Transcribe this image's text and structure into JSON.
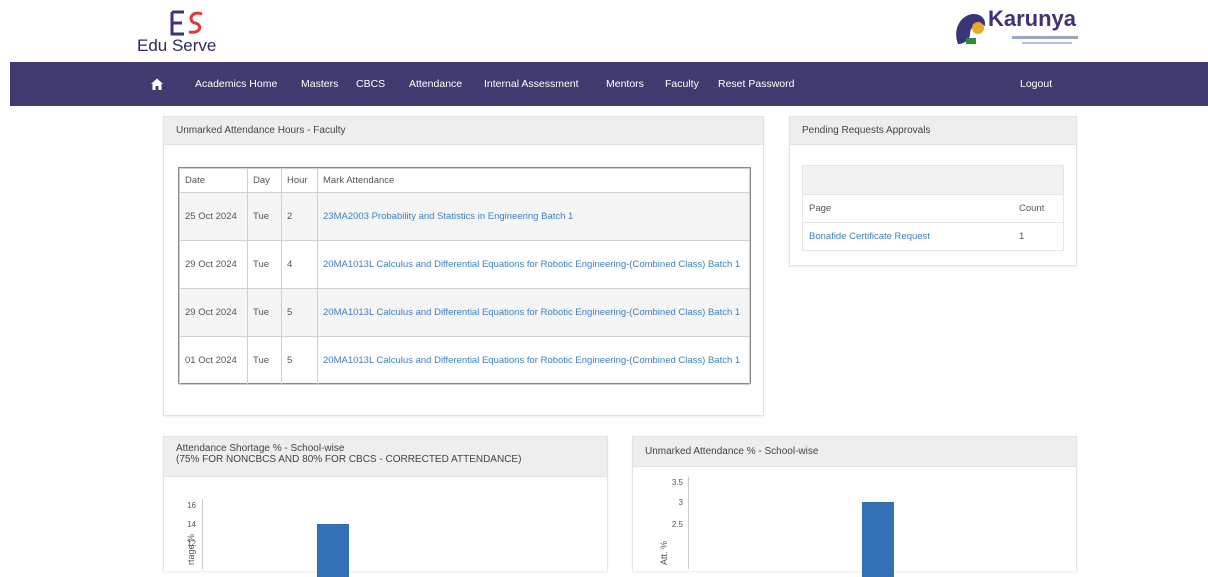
{
  "brand": {
    "name": "Edu Serve",
    "partner": "Karunya"
  },
  "nav": {
    "items": [
      "Academics Home",
      "Masters",
      "CBCS",
      "Attendance",
      "Internal Assessment",
      "Mentors",
      "Faculty",
      "Reset Password"
    ],
    "logout": "Logout"
  },
  "unmarked": {
    "title": "Unmarked Attendance Hours - Faculty",
    "headers": [
      "Date",
      "Day",
      "Hour",
      "Mark Attendance"
    ],
    "rows": [
      {
        "date": "25 Oct 2024",
        "day": "Tue",
        "hour": "2",
        "course": "23MA2003 Probability and Statistics in Engineering Batch 1"
      },
      {
        "date": "29 Oct 2024",
        "day": "Tue",
        "hour": "4",
        "course": "20MA1013L Calculus and Differential Equations for Robotic Engineering-(Combined Class) Batch 1"
      },
      {
        "date": "29 Oct 2024",
        "day": "Tue",
        "hour": "5",
        "course": "20MA1013L Calculus and Differential Equations for Robotic Engineering-(Combined Class) Batch 1"
      },
      {
        "date": "01 Oct 2024",
        "day": "Tue",
        "hour": "5",
        "course": "20MA1013L Calculus and Differential Equations for Robotic Engineering-(Combined Class) Batch 1"
      }
    ]
  },
  "pending": {
    "title": "Pending Requests Approvals",
    "headers": [
      "Page",
      "Count"
    ],
    "rows": [
      {
        "page": "Bonafide Certificate Request",
        "count": "1"
      }
    ]
  },
  "shortage_chart": {
    "title": "Attendance Shortage % - School-wise",
    "subtitle": "(75% FOR NONCBCS AND 80% FOR CBCS - CORRECTED ATTENDANCE)",
    "ylabel": "rtage %",
    "ticks": [
      "16",
      "14",
      "12"
    ]
  },
  "unmarked_chart": {
    "title": "Unmarked Attendance % - School-wise",
    "ylabel": "Att. %",
    "ticks": [
      "3.5",
      "3",
      "2.5"
    ]
  },
  "chart_data": [
    {
      "type": "bar",
      "title": "Attendance Shortage % - School-wise",
      "ylabel": "rtage %",
      "values": [
        14
      ],
      "ylim": [
        11,
        17
      ]
    },
    {
      "type": "bar",
      "title": "Unmarked Attendance % - School-wise",
      "ylabel": "Att. %",
      "values": [
        3
      ],
      "ylim": [
        2,
        3.8
      ]
    }
  ],
  "colors": {
    "nav": "#403b6e",
    "link": "#3d7fc2",
    "bar": "#3271b5"
  }
}
